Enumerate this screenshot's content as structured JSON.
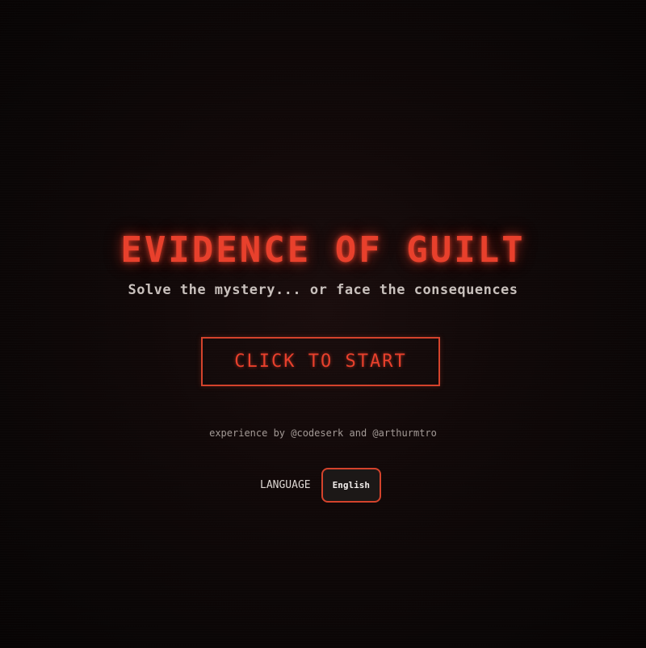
{
  "game": {
    "title": "EVIDENCE OF GUILT",
    "subtitle": "Solve the mystery... or face the consequences",
    "start_label": "CLICK TO START",
    "credits": "experience by @codeserk and @arthurmtro"
  },
  "language": {
    "label": "LANGUAGE",
    "selected": "English"
  },
  "colors": {
    "accent": "#e8402c",
    "border": "#d4432c",
    "background": "#0d0707"
  }
}
